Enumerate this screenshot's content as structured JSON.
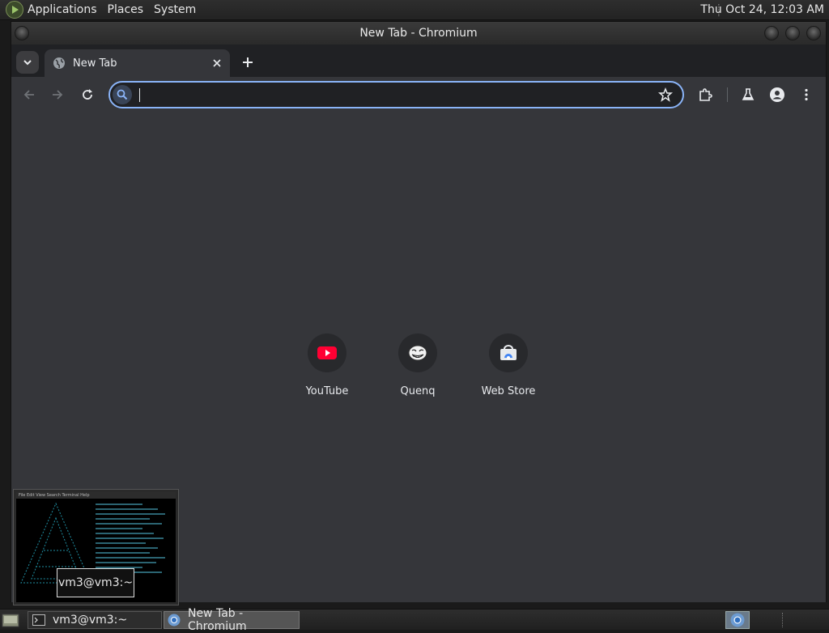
{
  "top_panel": {
    "menus": [
      "Applications",
      "Places",
      "System"
    ],
    "clock": "Thu Oct 24, 12:03 AM"
  },
  "window": {
    "title": "New Tab - Chromium"
  },
  "browser": {
    "tab_title": "New Tab",
    "omnibox": {
      "value": "",
      "placeholder": ""
    },
    "shortcuts": [
      {
        "label": "YouTube",
        "icon": "youtube-icon",
        "color": "#ff0033"
      },
      {
        "label": "Quenq",
        "icon": "trollface-icon",
        "color": "#ffffff"
      },
      {
        "label": "Web Store",
        "icon": "web-store-icon",
        "color": "#4285f4"
      }
    ]
  },
  "terminal_preview": {
    "tooltip": "vm3@vm3:~",
    "menubar": "File  Edit  View  Search  Terminal  Help"
  },
  "taskbar": {
    "tasks": [
      {
        "label": "vm3@vm3:~",
        "icon": "terminal-icon"
      },
      {
        "label": "New Tab - Chromium",
        "icon": "chromium-icon"
      }
    ]
  },
  "colors": {
    "accent": "#8ab4f8",
    "content_bg": "#35363a",
    "tab_strip_bg": "#202124"
  }
}
